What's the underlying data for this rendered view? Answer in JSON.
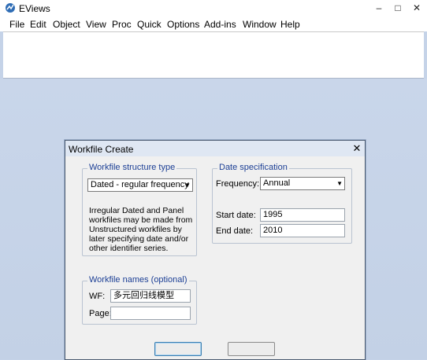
{
  "app": {
    "title": "EViews",
    "icon": "eviews-logo-icon"
  },
  "window_controls": {
    "minimize": "–",
    "maximize": "□",
    "close": "✕"
  },
  "menubar": {
    "items": [
      "File",
      "Edit",
      "Object",
      "View",
      "Proc",
      "Quick",
      "Options",
      "Add-ins",
      "Window",
      "Help"
    ]
  },
  "dialog": {
    "title": "Workfile Create",
    "close_glyph": "✕",
    "structure": {
      "legend": "Workfile structure type",
      "selected": "Dated - regular frequency",
      "note": "Irregular Dated and Panel workfiles may be made from Unstructured workfiles by later specifying date and/or other identifier series."
    },
    "date_spec": {
      "legend": "Date specification",
      "frequency_label": "Frequency:",
      "frequency_value": "Annual",
      "start_label": "Start date:",
      "start_value": "1995",
      "end_label": "End date:",
      "end_value": "2010"
    },
    "names": {
      "legend": "Workfile names (optional)",
      "wf_label": "WF:",
      "wf_value": "多元回归线模型",
      "page_label": "Page:",
      "page_value": ""
    },
    "buttons": {
      "ok": "",
      "cancel": ""
    }
  },
  "colors": {
    "legend_text": "#1c3f95",
    "workspace": "#c5d3e8"
  }
}
